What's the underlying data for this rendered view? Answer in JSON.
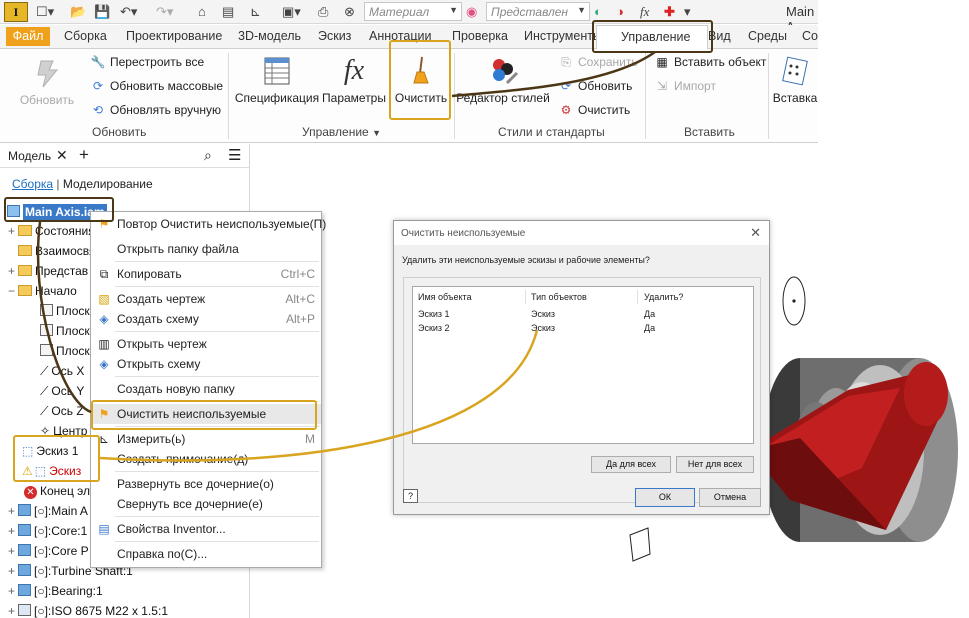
{
  "quick_access": {
    "logo_letter": "I",
    "material_combo": "Материал",
    "view_combo": "Представлен",
    "fx_symbol": "fx",
    "document_title": "Main A"
  },
  "tabs": [
    "Файл",
    "Сборка",
    "Проектирование",
    "3D-модель",
    "Эскиз",
    "Аннотации",
    "Проверка",
    "Инструменты",
    "Управление",
    "Вид",
    "Среды",
    "Со"
  ],
  "ribbon": {
    "update_group": {
      "update_big": "Обновить",
      "rebuild_all": "Перестроить все",
      "update_mass": "Обновить массовые",
      "update_manual": "Обновлять вручную",
      "label": "Обновить"
    },
    "manage_group": {
      "spec": "Спецификация",
      "params": "Параметры",
      "purge": "Очистить",
      "label": "Управление"
    },
    "styles_group": {
      "editor": "Редактор стилей",
      "save": "Сохранить",
      "update": "Обновить",
      "purge": "Очистить",
      "label": "Стили и стандарты"
    },
    "insert_group": {
      "insert_object": "Вставить объект",
      "import": "Импорт",
      "label": "Вставить"
    },
    "insert_big": "Вставка"
  },
  "browser": {
    "tab_model": "Модель",
    "link_assembly": "Сборка",
    "link_modeling": "Моделирование",
    "root": "Main Axis.iam",
    "items": [
      "Состояния",
      "Взаимосвя",
      "Представ",
      "Начало",
      "Плоско",
      "Плоско",
      "Плоско",
      "Ось X",
      "Ось Y",
      "Ось Z",
      "Центр",
      "Эскиз 1",
      "Эскиз",
      "Конец эле",
      "[○]:Main A",
      "[○]:Core:1",
      "[○]:Core P",
      "[○]:Turbine Shaft:1",
      "[○]:Bearing:1",
      "[○]:ISO 8675 M22 x 1.5:1"
    ]
  },
  "context_menu": {
    "items": [
      {
        "label": "Повтор Очистить неиспользуемые(П)",
        "shortcut": ""
      },
      {
        "label": "Открыть папку файла",
        "shortcut": ""
      },
      {
        "label": "Копировать",
        "shortcut": "Ctrl+C"
      },
      {
        "label": "Создать чертеж",
        "shortcut": "Alt+C"
      },
      {
        "label": "Создать схему",
        "shortcut": "Alt+P"
      },
      {
        "label": "Открыть чертеж",
        "shortcut": ""
      },
      {
        "label": "Открыть схему",
        "shortcut": ""
      },
      {
        "label": "Создать новую папку",
        "shortcut": ""
      },
      {
        "label": "Очистить неиспользуемые",
        "shortcut": ""
      },
      {
        "label": "Измерить(ь)",
        "shortcut": "M"
      },
      {
        "label": "Создать примечание(д)",
        "shortcut": ""
      },
      {
        "label": "Развернуть все дочерние(о)",
        "shortcut": ""
      },
      {
        "label": "Свернуть все дочерние(е)",
        "shortcut": ""
      },
      {
        "label": "Свойства Inventor...",
        "shortcut": ""
      },
      {
        "label": "Справка по(С)...",
        "shortcut": ""
      }
    ]
  },
  "dialog": {
    "title": "Очистить неиспользуемые",
    "message": "Удалить эти неиспользуемые эскизы и рабочие элементы?",
    "columns": [
      "Имя объекта",
      "Тип объектов",
      "Удалить?"
    ],
    "rows": [
      [
        "Эскиз 1",
        "Эскиз",
        "Да"
      ],
      [
        "Эскиз 2",
        "Эскиз",
        "Да"
      ]
    ],
    "yes_all": "Да для всех",
    "no_all": "Нет для всех",
    "ok": "ОК",
    "cancel": "Отмена"
  },
  "colors": {
    "accent_file_tab": "#f0a11c",
    "callout_gold": "#d9a520",
    "callout_brown": "#4b3716",
    "part_red": "#9e1515"
  }
}
